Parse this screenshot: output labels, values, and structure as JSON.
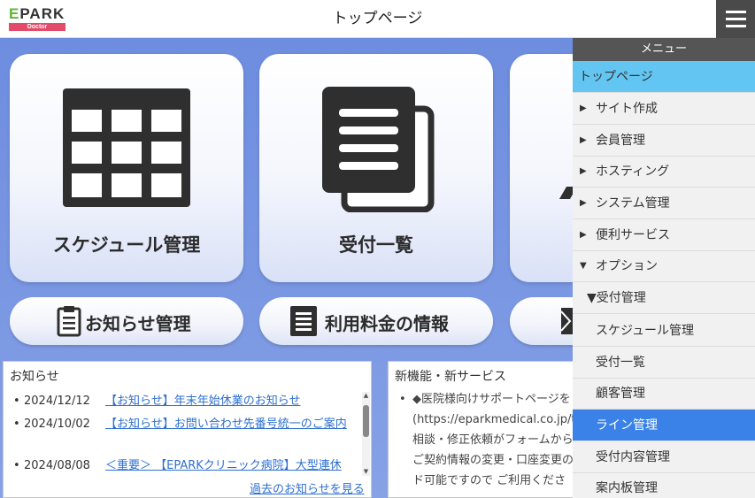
{
  "header": {
    "logo_top": "EPARK",
    "logo_sub": "Doctor",
    "title": "トップページ"
  },
  "tiles": [
    {
      "label": "スケジュール管理",
      "icon": "calendar-grid-icon"
    },
    {
      "label": "受付一覧",
      "icon": "documents-icon"
    }
  ],
  "pills": [
    {
      "label": "お知らせ管理",
      "icon": "clipboard-icon"
    },
    {
      "label": "利用料金の情報",
      "icon": "list-document-icon"
    }
  ],
  "news": {
    "title": "お知らせ",
    "items": [
      {
        "date": "2024/12/12",
        "text": "【お知らせ】年末年始休業のお知らせ"
      },
      {
        "date": "2024/10/02",
        "text": "【お知らせ】お問い合わせ先番号統一のご案内"
      },
      {
        "date": "2024/08/08",
        "text": "＜重要＞ 【EPARKクリニック病院】大型連休"
      }
    ],
    "more": "過去のお知らせを見る"
  },
  "services": {
    "title": "新機能・新サービス",
    "lines": [
      "◆医院様向けサポートページを",
      "(https://eparkmedical.co.jp/to",
      "相談・修正依頼がフォームから",
      "ご契約情報の変更・口座変更の",
      "ド可能ですので ご利用くださ"
    ]
  },
  "menu": {
    "title": "メニュー",
    "items": [
      {
        "label": "トップページ",
        "arrow": ""
      },
      {
        "label": "サイト作成",
        "arrow": "▶"
      },
      {
        "label": "会員管理",
        "arrow": "▶"
      },
      {
        "label": "ホスティング",
        "arrow": "▶"
      },
      {
        "label": "システム管理",
        "arrow": "▶"
      },
      {
        "label": "便利サービス",
        "arrow": "▶"
      },
      {
        "label": "オプション",
        "arrow": "▼"
      },
      {
        "label": "▼受付管理",
        "arrow": ""
      },
      {
        "label": "スケジュール管理",
        "arrow": ""
      },
      {
        "label": "受付一覧",
        "arrow": ""
      },
      {
        "label": "顧客管理",
        "arrow": ""
      },
      {
        "label": "ライン管理",
        "arrow": ""
      },
      {
        "label": "受付内容管理",
        "arrow": ""
      },
      {
        "label": "案内板管理",
        "arrow": ""
      }
    ]
  },
  "colors": {
    "menu_active": "#63c6f2",
    "menu_highlight": "#3b82e8",
    "header_button": "#4a4a4a",
    "link": "#2e6fd1"
  }
}
